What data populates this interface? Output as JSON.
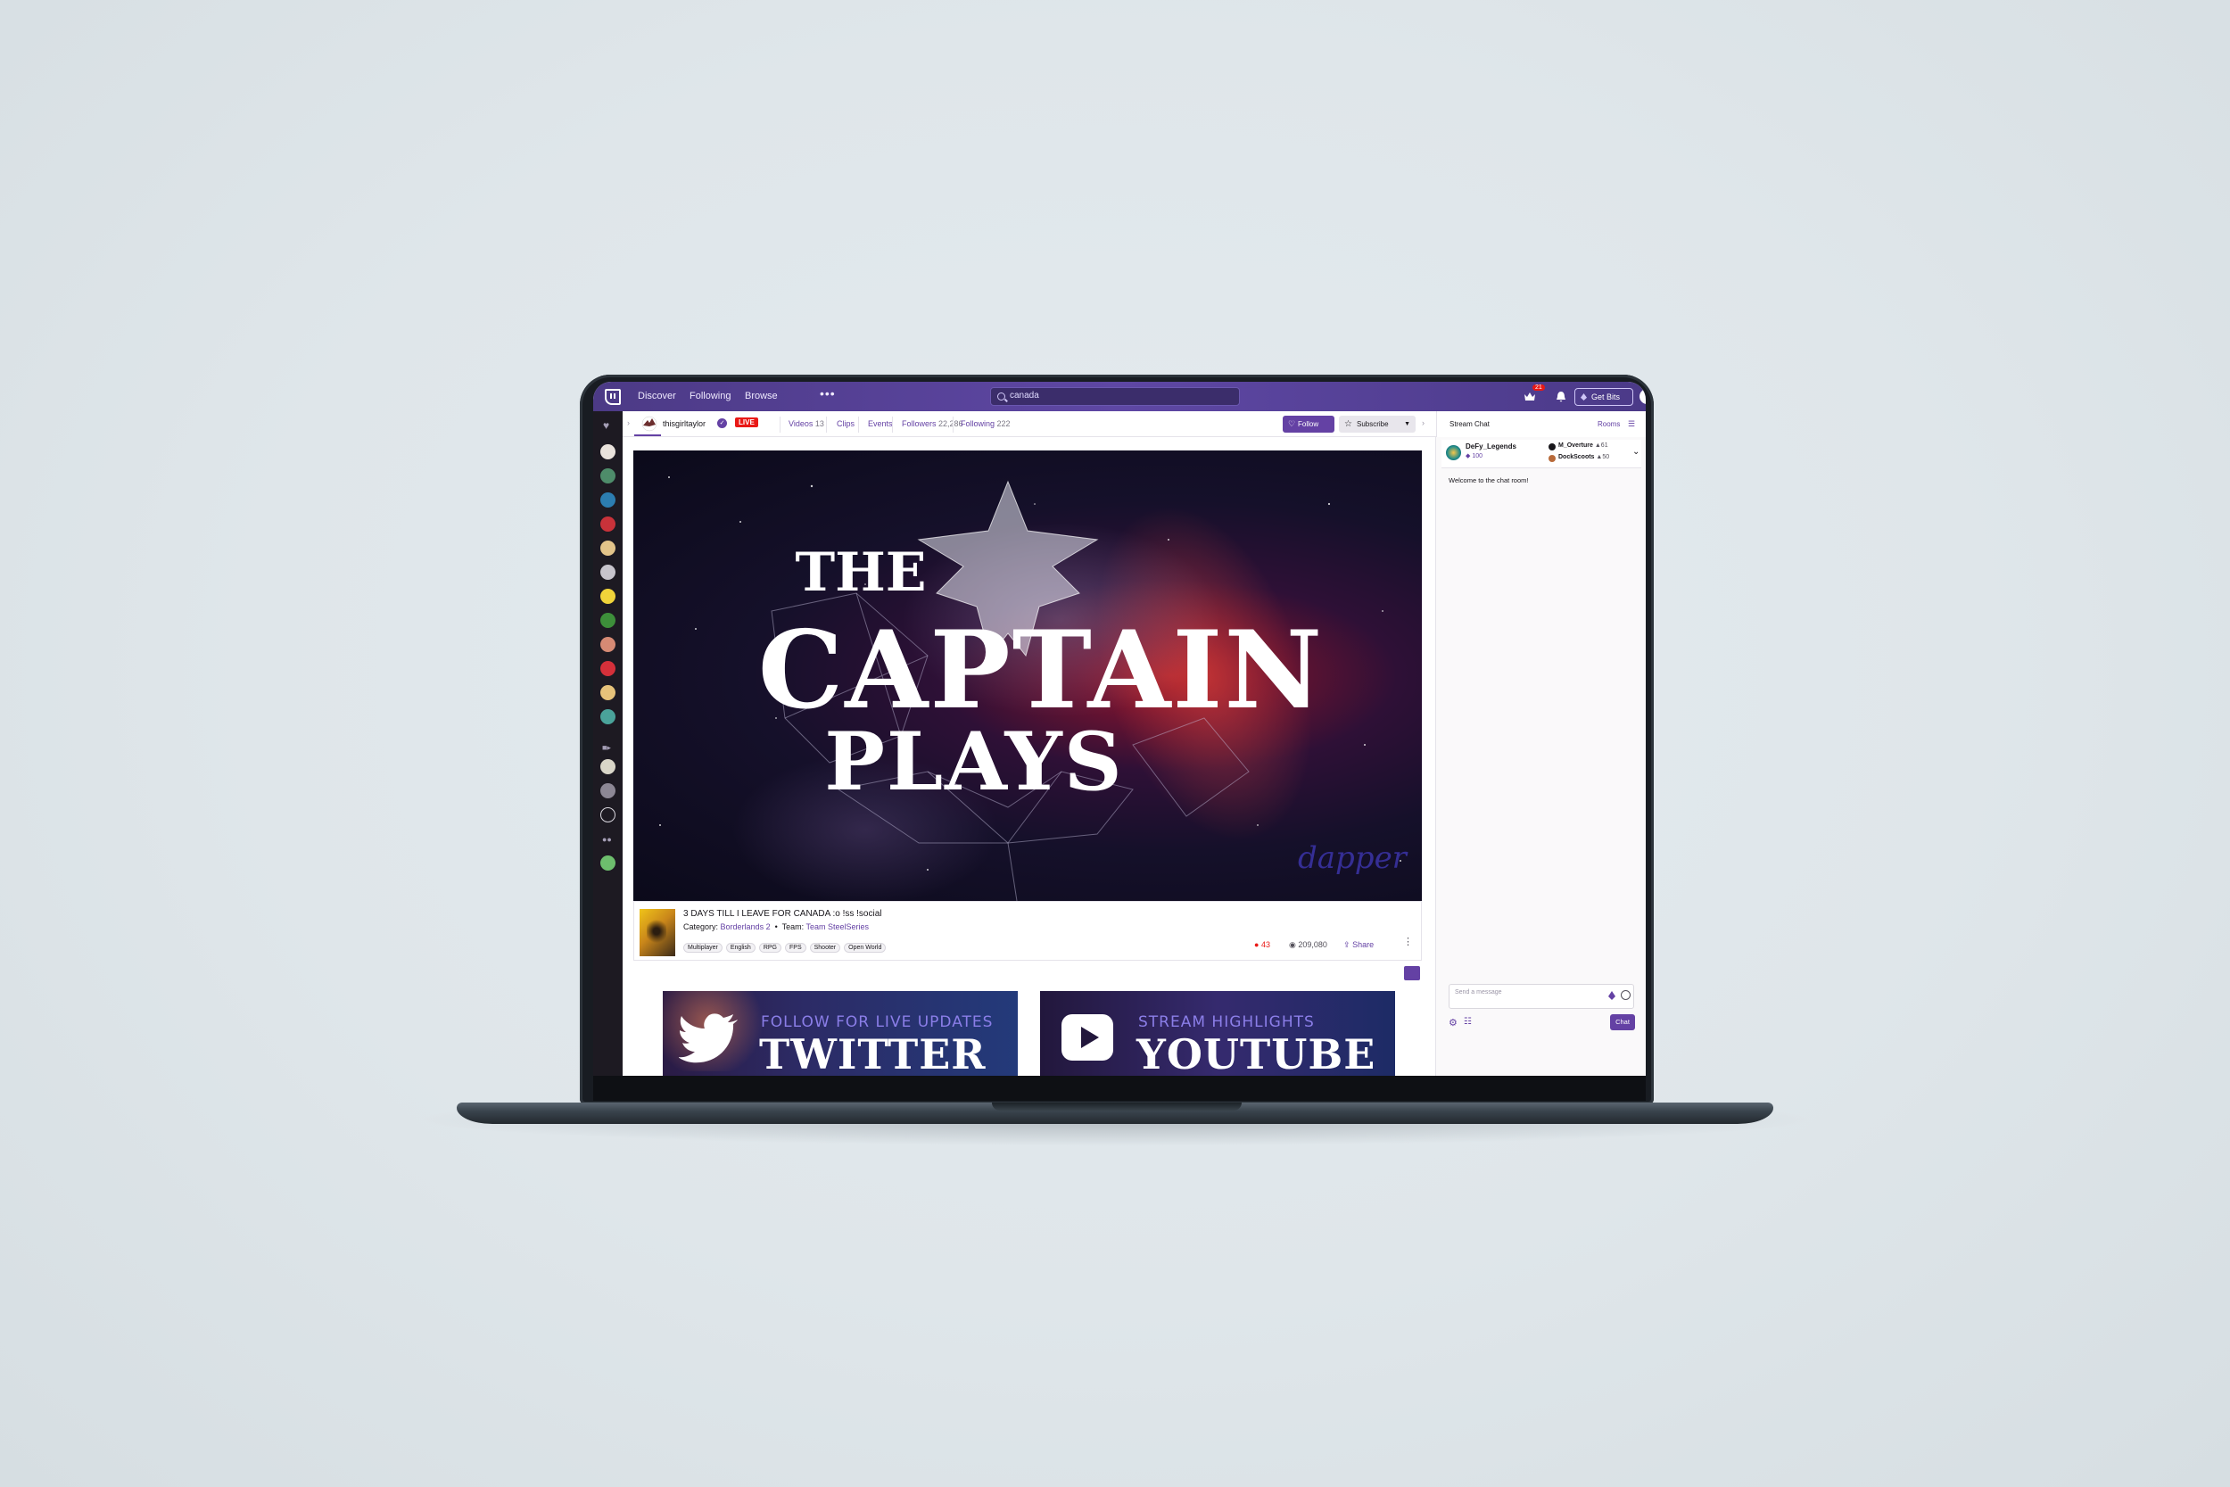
{
  "nav": {
    "discover": "Discover",
    "following": "Following",
    "browse": "Browse",
    "more": "•••",
    "search_value": "canada",
    "notification_count": "21",
    "get_bits": "Get Bits"
  },
  "channel": {
    "name": "thisgirltaylor",
    "live": "LIVE",
    "tabs": [
      {
        "label": "Videos",
        "count": "13"
      },
      {
        "label": "Clips",
        "count": ""
      },
      {
        "label": "Events",
        "count": ""
      },
      {
        "label": "Followers",
        "count": "22,286"
      },
      {
        "label": "Following",
        "count": "222"
      }
    ],
    "follow": "Follow",
    "subscribe": "Subscribe"
  },
  "video": {
    "overlay_line1": "THE",
    "overlay_line2": "CAPTAIN",
    "overlay_line3": "PLAYS",
    "watermark": "dapper"
  },
  "stream": {
    "title": "3 DAYS TILL I LEAVE FOR CANADA :o !ss !social",
    "category_label": "Category:",
    "category": "Borderlands 2",
    "sep": "•",
    "team_label": "Team:",
    "team": "Team SteelSeries",
    "tags": [
      "Multiplayer",
      "English",
      "RPG",
      "FPS",
      "Shooter",
      "Open World"
    ],
    "viewers": "43",
    "views": "209,080",
    "share": "Share"
  },
  "panels": [
    {
      "small": "FOLLOW FOR LIVE UPDATES",
      "big": "TWITTER"
    },
    {
      "small": "STREAM HIGHLIGHTS",
      "big": "YOUTUBE"
    }
  ],
  "chat": {
    "title": "Stream Chat",
    "rooms": "Rooms",
    "leader1_name": "DeFy_Legends",
    "leader1_bits": "100",
    "leader2_name": "M_Overture",
    "leader2_bits": "61",
    "leader3_name": "DockScoots",
    "leader3_bits": "50",
    "welcome": "Welcome to the chat room!",
    "placeholder": "Send a message",
    "send": "Chat"
  },
  "colors": {
    "brand": "#6441a4",
    "nav_bg": "#5a44a0",
    "live": "#e91916",
    "sidebar": "#1d1a22"
  }
}
